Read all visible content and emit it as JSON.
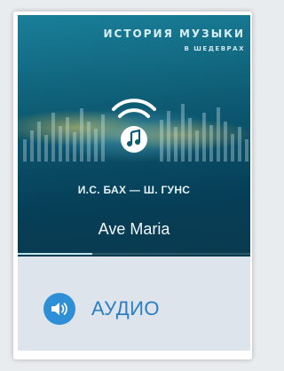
{
  "series": {
    "title": "ИСТОРИЯ МУЗЫКИ",
    "subtitle": "В ШЕДЕВРАХ"
  },
  "track": {
    "composer": "И.С. БАХ — Ш. ГУНС",
    "work": "Ave Maria",
    "progress": 0.32
  },
  "audio_button": {
    "label": "АУДИО",
    "icon": "speaker-icon"
  },
  "colors": {
    "accent": "#2f8fd6",
    "label": "#2b7fc2",
    "cover_top": "#1a7f99",
    "cover_bottom": "#063f58",
    "footer_bg": "#dde4ec"
  }
}
